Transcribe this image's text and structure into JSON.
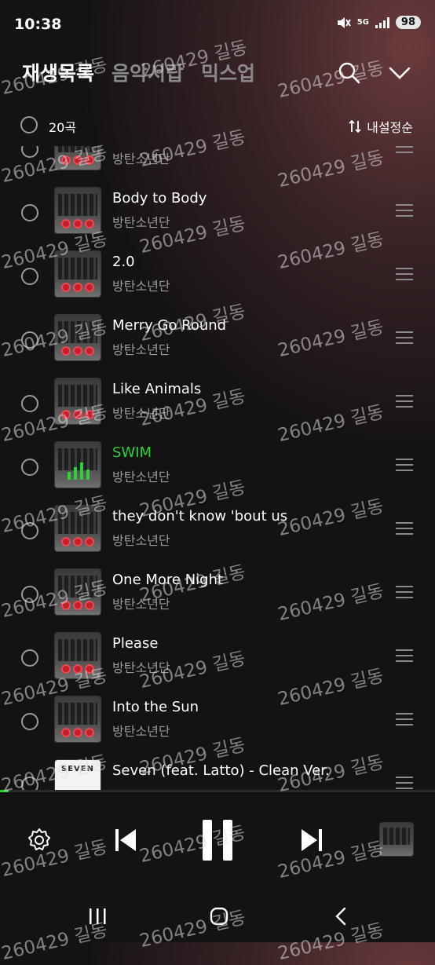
{
  "status_bar": {
    "time": "10:38",
    "network": "5G",
    "battery": "98"
  },
  "tabs": [
    {
      "label": "재생목록",
      "active": true
    },
    {
      "label": "음악서랍",
      "active": false
    },
    {
      "label": "믹스업",
      "active": false
    }
  ],
  "header": {
    "search_icon": "search-icon",
    "collapse_icon": "chevron-down-icon"
  },
  "playlist": {
    "count_label": "20곡",
    "sort_label": "내설정순",
    "tracks": [
      {
        "title": "",
        "artist": "방탄소년단",
        "playing": false,
        "art": "album"
      },
      {
        "title": "Body to Body",
        "artist": "방탄소년단",
        "playing": false,
        "art": "album"
      },
      {
        "title": "2.0",
        "artist": "방탄소년단",
        "playing": false,
        "art": "album"
      },
      {
        "title": "Merry Go Round",
        "artist": "방탄소년단",
        "playing": false,
        "art": "album"
      },
      {
        "title": "Like Animals",
        "artist": "방탄소년단",
        "playing": false,
        "art": "album"
      },
      {
        "title": "SWIM",
        "artist": "방탄소년단",
        "playing": true,
        "art": "album"
      },
      {
        "title": "they don't know 'bout us",
        "artist": "방탄소년단",
        "playing": false,
        "art": "album"
      },
      {
        "title": "One More Night",
        "artist": "방탄소년단",
        "playing": false,
        "art": "album"
      },
      {
        "title": "Please",
        "artist": "방탄소년단",
        "playing": false,
        "art": "album"
      },
      {
        "title": "Into the Sun",
        "artist": "방탄소년단",
        "playing": false,
        "art": "album"
      },
      {
        "title": "Seven (feat. Latto) - Clean Ver.",
        "artist": "",
        "playing": false,
        "art": "seven",
        "art_text": "SEVEN"
      }
    ]
  },
  "playback": {
    "progress_fraction": 0.02
  },
  "player_controls": {
    "settings_icon": "gear-icon",
    "prev_icon": "skip-previous-icon",
    "pause_icon": "pause-icon",
    "next_icon": "skip-next-icon"
  },
  "watermark": "260429 길동",
  "colors": {
    "accent": "#2bd13b",
    "background": "#141213"
  }
}
